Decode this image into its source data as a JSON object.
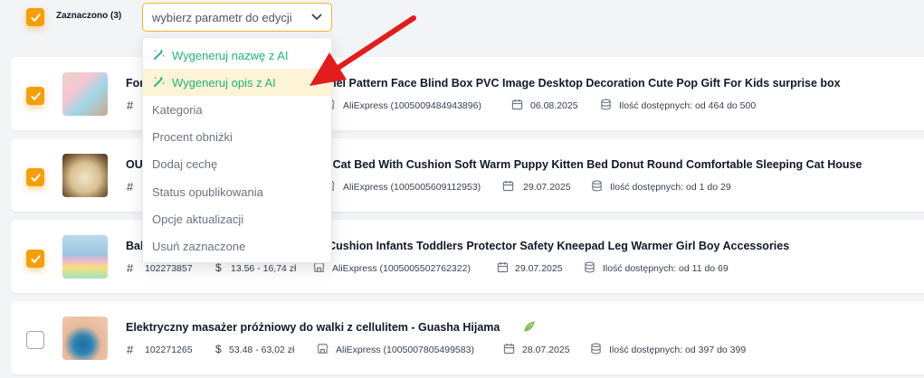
{
  "toolbar": {
    "selected_label": "Zaznaczono (3)",
    "select_placeholder": "wybierz parametr do edycji"
  },
  "dropdown": {
    "items": [
      {
        "label": "Wygeneruj nazwę z AI",
        "ai": true
      },
      {
        "label": "Wygeneruj opis z AI",
        "ai": true
      },
      {
        "label": "Kategoria"
      },
      {
        "label": "Procent obniżki"
      },
      {
        "label": "Dodaj cechę"
      },
      {
        "label": "Status opublikowania"
      },
      {
        "label": "Opcje aktualizacji"
      },
      {
        "label": "Usuń zaznaczone"
      }
    ]
  },
  "products": [
    {
      "checked": true,
      "title_visible": "imel Pattern Face Blind Box PVC Image Desktop Decoration Cute Pop Gift For Kids surprise box",
      "title_prefix": "For",
      "source": "AliExpress (1005009484943896)",
      "date": "06.08.2025",
      "stock": "Ilość dostępnych: od 464 do 500"
    },
    {
      "checked": true,
      "title_prefix": "OU",
      "title_visible": "et Cat Bed With Cushion Soft Warm Puppy Kitten Bed Donut Round Comfortable Sleeping Cat House",
      "source": "AliExpress (1005005609112953)",
      "date": "29.07.2025",
      "stock": "Ilość dostępnych: od 1 do 29"
    },
    {
      "checked": true,
      "title_prefix": "Bab",
      "title_visible": "g Cushion Infants Toddlers Protector Safety Kneepad Leg Warmer Girl Boy Accessories",
      "id": "102273857",
      "price": "13.56 - 16,74 zł",
      "source": "AliExpress (1005005502762322)",
      "date": "29.07.2025",
      "stock": "Ilość dostępnych: od 11 do 69"
    },
    {
      "checked": false,
      "title": "Elektryczny masażer próżniowy do walki z cellulitem - Guasha Hijama",
      "id": "102271265",
      "price": "53.48 - 63,02 zł",
      "source": "AliExpress (1005007805499583)",
      "date": "28.07.2025",
      "stock": "Ilość dostępnych: od 397 do 399"
    }
  ],
  "colors": {
    "accent": "#f59e0b",
    "ai_green": "#22b37a",
    "arrow": "#e11d1d"
  }
}
